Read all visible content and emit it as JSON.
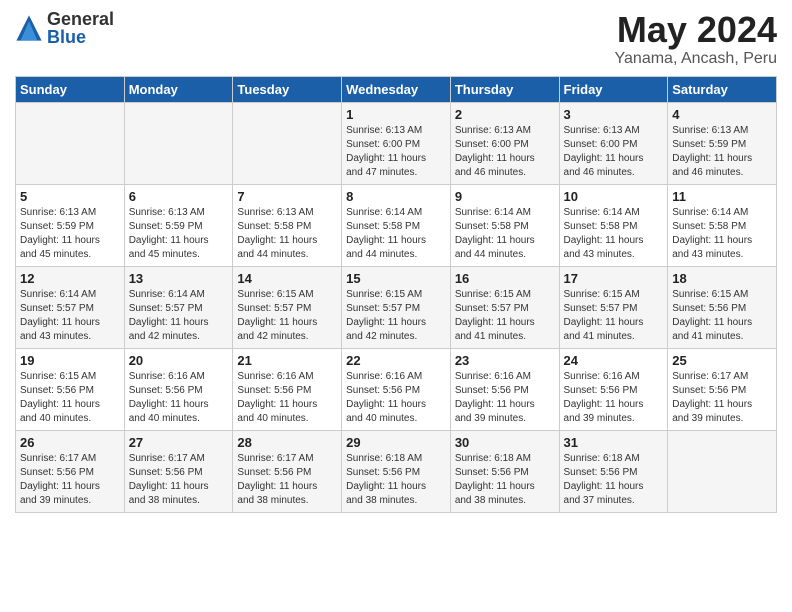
{
  "logo": {
    "general": "General",
    "blue": "Blue"
  },
  "title": {
    "month": "May 2024",
    "location": "Yanama, Ancash, Peru"
  },
  "weekdays": [
    "Sunday",
    "Monday",
    "Tuesday",
    "Wednesday",
    "Thursday",
    "Friday",
    "Saturday"
  ],
  "weeks": [
    [
      {
        "day": "",
        "info": ""
      },
      {
        "day": "",
        "info": ""
      },
      {
        "day": "",
        "info": ""
      },
      {
        "day": "1",
        "info": "Sunrise: 6:13 AM\nSunset: 6:00 PM\nDaylight: 11 hours\nand 47 minutes."
      },
      {
        "day": "2",
        "info": "Sunrise: 6:13 AM\nSunset: 6:00 PM\nDaylight: 11 hours\nand 46 minutes."
      },
      {
        "day": "3",
        "info": "Sunrise: 6:13 AM\nSunset: 6:00 PM\nDaylight: 11 hours\nand 46 minutes."
      },
      {
        "day": "4",
        "info": "Sunrise: 6:13 AM\nSunset: 5:59 PM\nDaylight: 11 hours\nand 46 minutes."
      }
    ],
    [
      {
        "day": "5",
        "info": "Sunrise: 6:13 AM\nSunset: 5:59 PM\nDaylight: 11 hours\nand 45 minutes."
      },
      {
        "day": "6",
        "info": "Sunrise: 6:13 AM\nSunset: 5:59 PM\nDaylight: 11 hours\nand 45 minutes."
      },
      {
        "day": "7",
        "info": "Sunrise: 6:13 AM\nSunset: 5:58 PM\nDaylight: 11 hours\nand 44 minutes."
      },
      {
        "day": "8",
        "info": "Sunrise: 6:14 AM\nSunset: 5:58 PM\nDaylight: 11 hours\nand 44 minutes."
      },
      {
        "day": "9",
        "info": "Sunrise: 6:14 AM\nSunset: 5:58 PM\nDaylight: 11 hours\nand 44 minutes."
      },
      {
        "day": "10",
        "info": "Sunrise: 6:14 AM\nSunset: 5:58 PM\nDaylight: 11 hours\nand 43 minutes."
      },
      {
        "day": "11",
        "info": "Sunrise: 6:14 AM\nSunset: 5:58 PM\nDaylight: 11 hours\nand 43 minutes."
      }
    ],
    [
      {
        "day": "12",
        "info": "Sunrise: 6:14 AM\nSunset: 5:57 PM\nDaylight: 11 hours\nand 43 minutes."
      },
      {
        "day": "13",
        "info": "Sunrise: 6:14 AM\nSunset: 5:57 PM\nDaylight: 11 hours\nand 42 minutes."
      },
      {
        "day": "14",
        "info": "Sunrise: 6:15 AM\nSunset: 5:57 PM\nDaylight: 11 hours\nand 42 minutes."
      },
      {
        "day": "15",
        "info": "Sunrise: 6:15 AM\nSunset: 5:57 PM\nDaylight: 11 hours\nand 42 minutes."
      },
      {
        "day": "16",
        "info": "Sunrise: 6:15 AM\nSunset: 5:57 PM\nDaylight: 11 hours\nand 41 minutes."
      },
      {
        "day": "17",
        "info": "Sunrise: 6:15 AM\nSunset: 5:57 PM\nDaylight: 11 hours\nand 41 minutes."
      },
      {
        "day": "18",
        "info": "Sunrise: 6:15 AM\nSunset: 5:56 PM\nDaylight: 11 hours\nand 41 minutes."
      }
    ],
    [
      {
        "day": "19",
        "info": "Sunrise: 6:15 AM\nSunset: 5:56 PM\nDaylight: 11 hours\nand 40 minutes."
      },
      {
        "day": "20",
        "info": "Sunrise: 6:16 AM\nSunset: 5:56 PM\nDaylight: 11 hours\nand 40 minutes."
      },
      {
        "day": "21",
        "info": "Sunrise: 6:16 AM\nSunset: 5:56 PM\nDaylight: 11 hours\nand 40 minutes."
      },
      {
        "day": "22",
        "info": "Sunrise: 6:16 AM\nSunset: 5:56 PM\nDaylight: 11 hours\nand 40 minutes."
      },
      {
        "day": "23",
        "info": "Sunrise: 6:16 AM\nSunset: 5:56 PM\nDaylight: 11 hours\nand 39 minutes."
      },
      {
        "day": "24",
        "info": "Sunrise: 6:16 AM\nSunset: 5:56 PM\nDaylight: 11 hours\nand 39 minutes."
      },
      {
        "day": "25",
        "info": "Sunrise: 6:17 AM\nSunset: 5:56 PM\nDaylight: 11 hours\nand 39 minutes."
      }
    ],
    [
      {
        "day": "26",
        "info": "Sunrise: 6:17 AM\nSunset: 5:56 PM\nDaylight: 11 hours\nand 39 minutes."
      },
      {
        "day": "27",
        "info": "Sunrise: 6:17 AM\nSunset: 5:56 PM\nDaylight: 11 hours\nand 38 minutes."
      },
      {
        "day": "28",
        "info": "Sunrise: 6:17 AM\nSunset: 5:56 PM\nDaylight: 11 hours\nand 38 minutes."
      },
      {
        "day": "29",
        "info": "Sunrise: 6:18 AM\nSunset: 5:56 PM\nDaylight: 11 hours\nand 38 minutes."
      },
      {
        "day": "30",
        "info": "Sunrise: 6:18 AM\nSunset: 5:56 PM\nDaylight: 11 hours\nand 38 minutes."
      },
      {
        "day": "31",
        "info": "Sunrise: 6:18 AM\nSunset: 5:56 PM\nDaylight: 11 hours\nand 37 minutes."
      },
      {
        "day": "",
        "info": ""
      }
    ]
  ]
}
